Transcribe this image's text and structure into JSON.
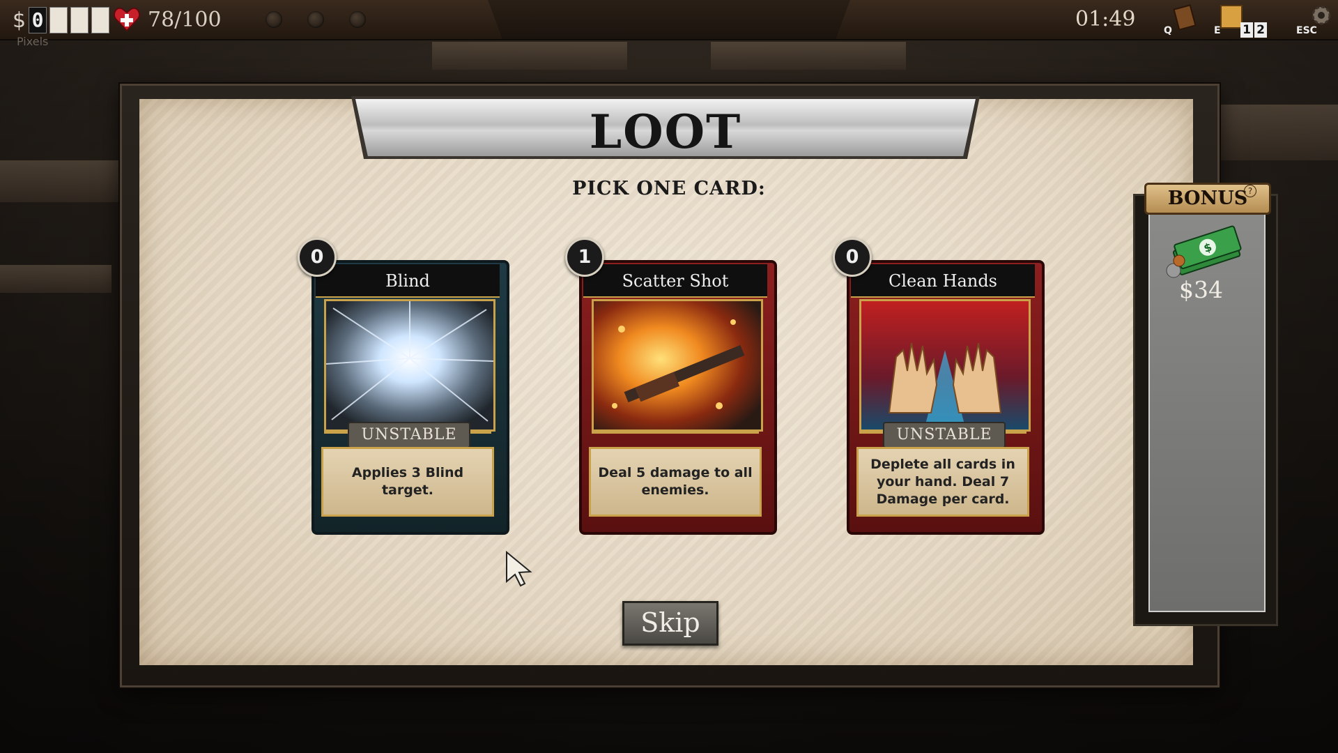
{
  "hud": {
    "money_symbol": "$",
    "money_digits": [
      "0",
      "",
      "",
      ""
    ],
    "pixels_label": "Pixels",
    "health": "78/100",
    "timer": "01:49",
    "hotkeys": {
      "q": "Q",
      "e": "E",
      "esc": "ESC"
    },
    "deck_counts": [
      "1",
      "2"
    ]
  },
  "loot": {
    "title": "LOOT",
    "subtitle": "PICK ONE CARD:",
    "skip_label": "Skip"
  },
  "cards": [
    {
      "cost": "0",
      "name": "Blind",
      "tag": "UNSTABLE",
      "description": "Applies 3 Blind target.",
      "color": "#1f3a44"
    },
    {
      "cost": "1",
      "name": "Scatter Shot",
      "tag": "",
      "description": "Deal 5 damage to all enemies.",
      "color": "#8c1f1f"
    },
    {
      "cost": "0",
      "name": "Clean Hands",
      "tag": "UNSTABLE",
      "description": "Deplete all cards in your hand. Deal 7 Damage per card.",
      "color": "#8c1f1f"
    }
  ],
  "bonus": {
    "title": "BONUS",
    "help_icon": "?",
    "amount": "$34"
  }
}
